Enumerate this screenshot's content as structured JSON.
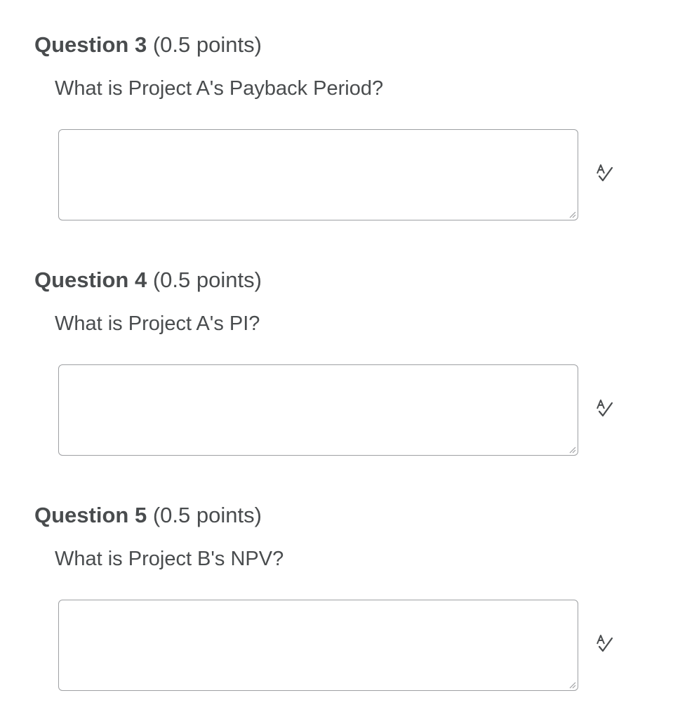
{
  "questions": [
    {
      "title": "Question 3",
      "points": "(0.5 points)",
      "prompt": "What is Project A's Payback Period?",
      "answer_value": "",
      "spellcheck_icon": "spellcheck-icon"
    },
    {
      "title": "Question 4",
      "points": "(0.5 points)",
      "prompt": "What is Project A's PI?",
      "answer_value": "",
      "spellcheck_icon": "spellcheck-icon"
    },
    {
      "title": "Question 5",
      "points": "(0.5 points)",
      "prompt": "What is Project B's NPV?",
      "answer_value": "",
      "spellcheck_icon": "spellcheck-icon"
    }
  ],
  "colors": {
    "text": "#494c4e",
    "border": "#9ea0a3",
    "background": "#ffffff"
  }
}
